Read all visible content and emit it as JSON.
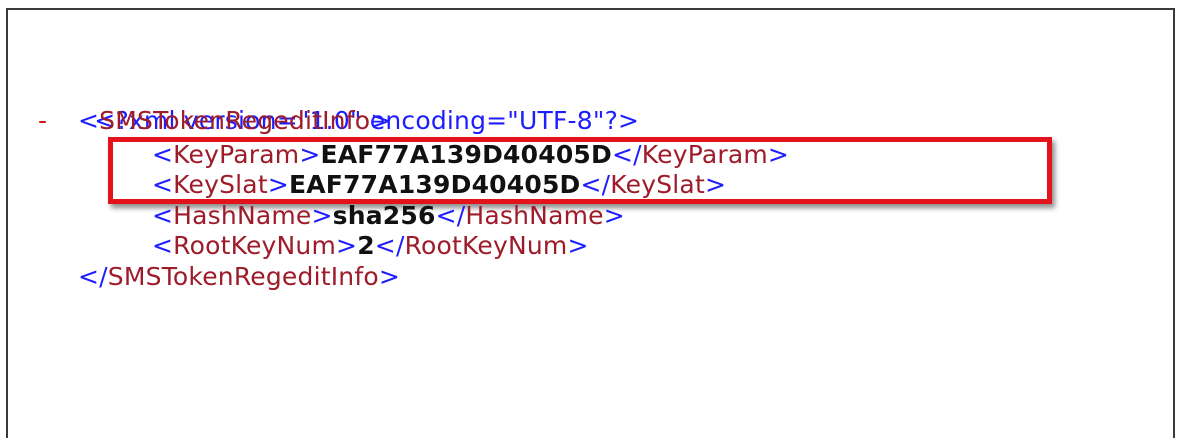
{
  "declaration": "<?xml version=\"1.0\" encoding=\"UTF-8\"?>",
  "collapse_symbol": "-",
  "root": {
    "open_tag": "SMSTokenRegeditInfo",
    "close_tag": "SMSTokenRegeditInfo"
  },
  "children": [
    {
      "tag": "KeyParam",
      "value": "EAF77A139D40405D"
    },
    {
      "tag": "KeySlat",
      "value": "EAF77A139D40405D"
    },
    {
      "tag": "HashName",
      "value": "sha256"
    },
    {
      "tag": "RootKeyNum",
      "value": "2"
    }
  ],
  "syntax": {
    "lt": "<",
    "gt": ">",
    "lt_slash": "</"
  },
  "colors": {
    "bracket": "#1d1dff",
    "tag": "#9e1b2a",
    "value": "#111111",
    "toggle": "#d01818",
    "highlight": "#e3131b"
  }
}
